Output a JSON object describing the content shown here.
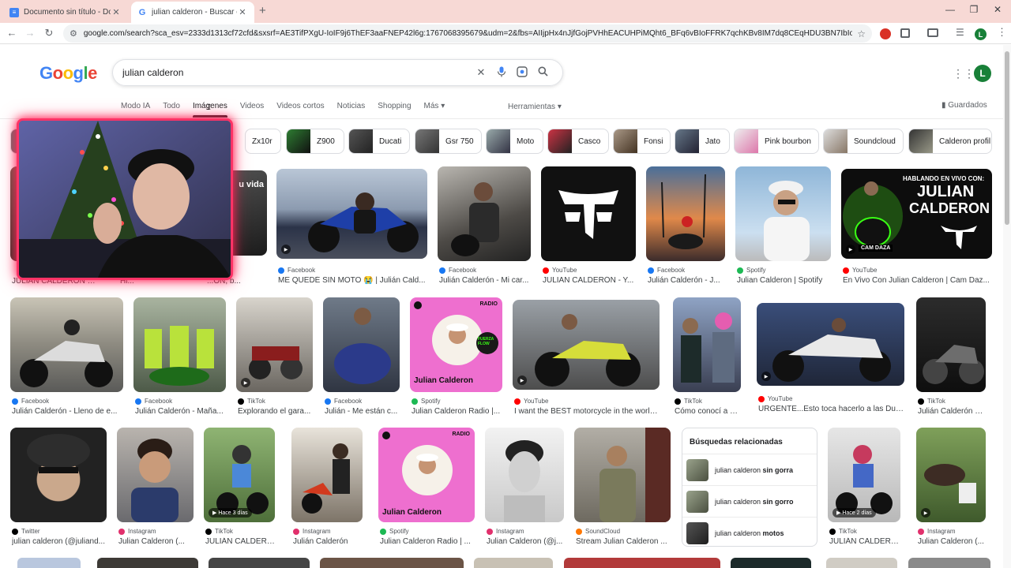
{
  "browser": {
    "tabs": [
      {
        "title": "Documento sin título - Docume",
        "favicon": "docs-icon"
      },
      {
        "title": "julian calderon - Buscar con Go",
        "favicon": "google-icon"
      }
    ],
    "url": "google.com/search?sca_esv=2333d1313cf72cfd&sxsrf=AE3TifPXgU-IoIF9j6ThEF3aaFNEP42l6g:1767068395679&udm=2&fbs=AIIjpHx4nJjfGojPVHhEACUHPiMQht6_BFq6vBIoFFRK7qchKBv8IM7dq8CEqHDU3BN7IbIo0LLC9Cn6mkAPuJ2pf...",
    "profile_initial": "L"
  },
  "google": {
    "logo": [
      "G",
      "o",
      "o",
      "g",
      "l",
      "e"
    ],
    "query": "julian calderon",
    "avatar_initial": "L",
    "tabs": [
      "Modo IA",
      "Todo",
      "Imágenes",
      "Videos",
      "Videos cortos",
      "Noticias",
      "Shopping",
      "Más"
    ],
    "more_caret": "▾",
    "tools": "Herramientas",
    "saved": "Guardados"
  },
  "chips": [
    "Zx10r",
    "Z900",
    "Ducati",
    "Gsr 750",
    "Moto",
    "Casco",
    "Fonsi",
    "Jato",
    "Pink bourbon",
    "Soundcloud",
    "Calderon profil"
  ],
  "row1": [
    {
      "source": "",
      "title": "JULIÁN CALDERÓN SA..."
    },
    {
      "source": "",
      "title": "Hi..."
    },
    {
      "source": "",
      "title": "...ÓN, b..."
    },
    {
      "source": "Facebook",
      "title": "ME QUEDÉ SIN MOTO 😭 | Julián Cald..."
    },
    {
      "source": "Facebook",
      "title": "Julián Calderón - Mi car..."
    },
    {
      "source": "YouTube",
      "title": "JULIAN CALDERÓN - Y..."
    },
    {
      "source": "Facebook",
      "title": "Julián Calderón - J..."
    },
    {
      "source": "Spotify",
      "title": "Julian Calderon | Spotify"
    },
    {
      "source": "YouTube",
      "title": "En Vivo Con Julian Calderon | Cam Daz..."
    }
  ],
  "row1_overlay_text": {
    "vida": "u vida",
    "hablando": "HABLANDO EN VIVO CON:",
    "julian": "JULIAN",
    "calderon": "CALDERON",
    "cam": "CAM DAZA"
  },
  "row2": [
    {
      "source": "Facebook",
      "title": "Julián Calderón - Lleno de e..."
    },
    {
      "source": "Facebook",
      "title": "Julián Calderón - Maña..."
    },
    {
      "source": "TikTok",
      "title": "Explorando el gara..."
    },
    {
      "source": "Facebook",
      "title": "Julián - Me están c..."
    },
    {
      "source": "Spotify",
      "title": "Julian Calderon Radio |..."
    },
    {
      "source": "YouTube",
      "title": "I want the BEST motorcycle in the world..."
    },
    {
      "source": "TikTok",
      "title": "Cómo conocí a Juli..."
    },
    {
      "source": "YouTube",
      "title": "URGENTE...Esto toca hacerlo a las Duc..."
    },
    {
      "source": "TikTok",
      "title": "Julián Calderón @..."
    }
  ],
  "row3": [
    {
      "source": "Twitter",
      "title": "julian calderon (@juliand..."
    },
    {
      "source": "Instagram",
      "title": "Julian Calderon (..."
    },
    {
      "source": "TikTok",
      "title": "JULIÁN CALDERÓ..."
    },
    {
      "source": "Instagram",
      "title": "Julián Calderón"
    },
    {
      "source": "Spotify",
      "title": "Julian Calderon Radio | ..."
    },
    {
      "source": "Instagram",
      "title": "Julian Calderon (@j..."
    },
    {
      "source": "SoundCloud",
      "title": "Stream Julian Calderon ..."
    },
    {
      "source": "TikTok",
      "title": "JULIÁN CALDERÓ..."
    },
    {
      "source": "Instagram",
      "title": "Julian Calderon (..."
    }
  ],
  "spotify_cover": {
    "radio": "RADIO",
    "name": "Julian Calderon",
    "fuerza": "FUERZA FLOW"
  },
  "badges": {
    "hace3": "Hace 3 días",
    "hace2": "Hace 2 días"
  },
  "related": {
    "title": "Búsquedas relacionadas",
    "items": [
      {
        "prefix": "julian calderon ",
        "bold": "sin gorra"
      },
      {
        "prefix": "julian calderon ",
        "bold": "sin gorro"
      },
      {
        "prefix": "julian calderon ",
        "bold": "motos"
      }
    ]
  },
  "colors": {
    "accent_pink": "#ff3366",
    "tab_bar": "#f7d9d5",
    "spotify_pink": "#ee6fcf",
    "neon_green": "#39ff14"
  }
}
